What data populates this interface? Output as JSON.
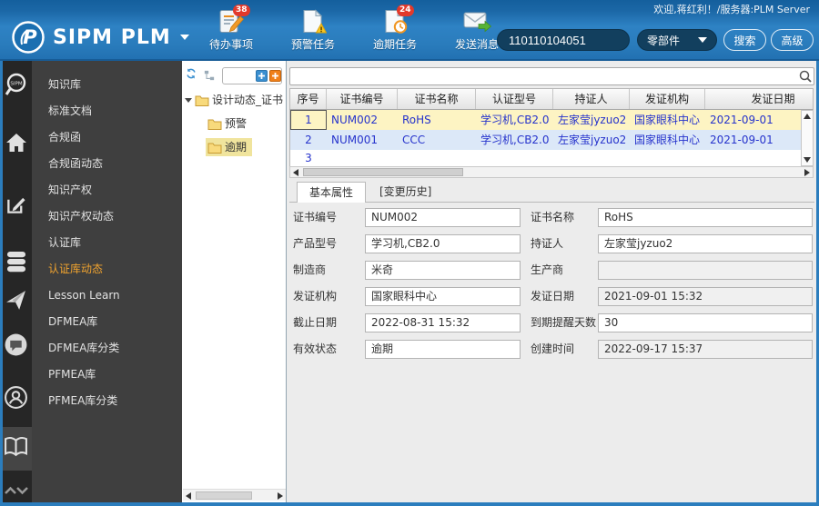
{
  "header": {
    "logo": "SIPM PLM",
    "welcome": "欢迎,蒋红利！/服务器:PLM Server",
    "tasks": [
      {
        "label": "待办事项",
        "badge": "38",
        "icon": "todo-document-icon"
      },
      {
        "label": "预警任务",
        "badge": "",
        "icon": "warning-document-icon"
      },
      {
        "label": "逾期任务",
        "badge": "24",
        "icon": "overdue-document-icon"
      },
      {
        "label": "发送消息",
        "badge": "",
        "icon": "send-message-icon"
      }
    ],
    "search": {
      "value": "110110104051",
      "category": "零部件",
      "search_label": "搜索",
      "advanced_label": "高级"
    }
  },
  "sidebar": {
    "icon_names": [
      "sipm-magnifier-icon",
      "home-icon",
      "edit-icon",
      "database-icon",
      "paper-plane-icon",
      "chat-icon",
      "support-icon",
      "open-book-icon",
      "scroll-chevrons-icon"
    ],
    "items": [
      {
        "label": "知识库"
      },
      {
        "label": "标准文档"
      },
      {
        "label": "合规函"
      },
      {
        "label": "合规函动态"
      },
      {
        "label": "知识产权"
      },
      {
        "label": "知识产权动态"
      },
      {
        "label": "认证库"
      },
      {
        "label": "认证库动态",
        "active": true
      },
      {
        "label": "Lesson Learn"
      },
      {
        "label": "DFMEA库"
      },
      {
        "label": "DFMEA库分类"
      },
      {
        "label": "PFMEA库"
      },
      {
        "label": "PFMEA库分类"
      }
    ]
  },
  "tree": {
    "root_label": "设计动态_证书",
    "children": [
      {
        "label": "预警"
      },
      {
        "label": "逾期",
        "selected": true
      }
    ]
  },
  "main": {
    "table": {
      "columns": [
        "序号",
        "证书编号",
        "证书名称",
        "认证型号",
        "持证人",
        "发证机构",
        "发证日期"
      ],
      "rows": [
        [
          "1",
          "NUM002",
          "RoHS",
          "学习机,CB2.0",
          "左家莹jyzuo2",
          "国家眼科中心",
          "2021-09-01"
        ],
        [
          "2",
          "NUM001",
          "CCC",
          "学习机,CB2.0",
          "左家莹jyzuo2",
          "国家眼科中心",
          "2021-09-01"
        ],
        [
          "3",
          "",
          "",
          "",
          "",
          "",
          ""
        ]
      ]
    },
    "tabs": [
      {
        "label": "基本属性",
        "active": true
      },
      {
        "label": "[变更历史]",
        "active": false
      }
    ],
    "form": {
      "rows": [
        {
          "l_label": "证书编号",
          "l_value": "NUM002",
          "r_label": "证书名称",
          "r_value": "RoHS"
        },
        {
          "l_label": "产品型号",
          "l_value": "学习机,CB2.0",
          "r_label": "持证人",
          "r_value": "左家莹jyzuo2"
        },
        {
          "l_label": "制造商",
          "l_value": "米奇",
          "r_label": "生产商",
          "r_value": ""
        },
        {
          "l_label": "发证机构",
          "l_value": "国家眼科中心",
          "r_label": "发证日期",
          "r_value": "2021-09-01 15:32"
        },
        {
          "l_label": "截止日期",
          "l_value": "2022-08-31 15:32",
          "r_label": "到期提醒天数",
          "r_value": "30"
        },
        {
          "l_label": "有效状态",
          "l_value": "逾期",
          "r_label": "创建时间",
          "r_value": "2022-09-17 15:37"
        }
      ]
    }
  },
  "colors": {
    "header_blue": "#2a7cbc",
    "accent_orange": "#f0a32f",
    "badge_red": "#e2392b",
    "row_selected_yellow": "#fdf4c3",
    "row_alt_blue": "#dce8f8",
    "table_text_blue": "#2633cc",
    "tree_selected_khaki": "#f0e49d"
  }
}
